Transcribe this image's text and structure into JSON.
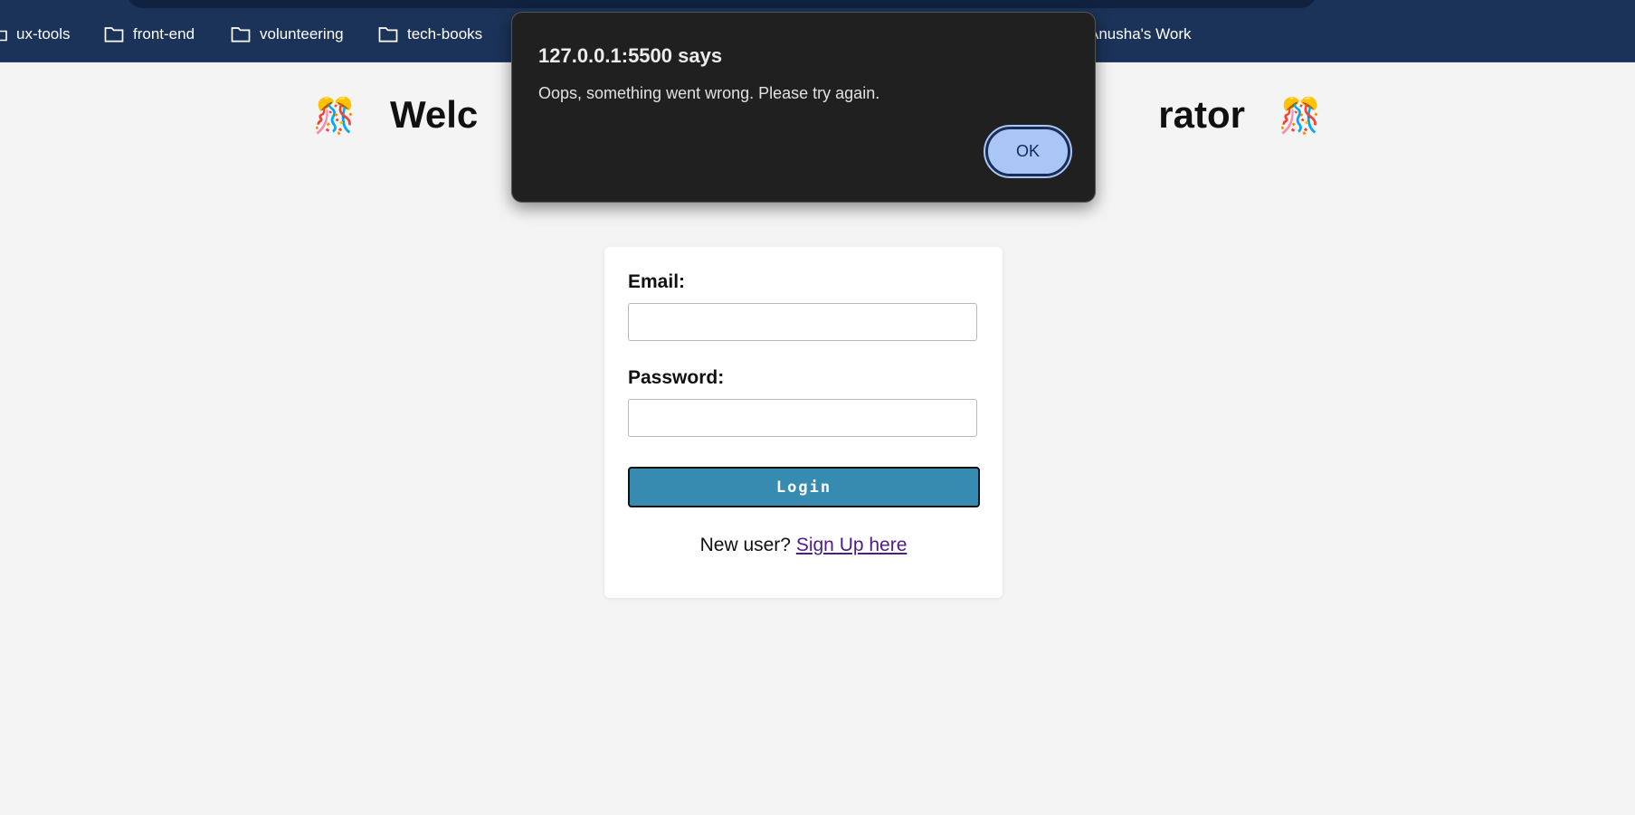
{
  "bookmarks": [
    {
      "label": "ux-tools",
      "icon": "folder-icon"
    },
    {
      "label": "front-end",
      "icon": "folder-icon"
    },
    {
      "label": "volunteering",
      "icon": "folder-icon"
    },
    {
      "label": "tech-books",
      "icon": "folder-icon"
    },
    {
      "label": "Anusha's Work",
      "icon": "none"
    }
  ],
  "page": {
    "title_visible_left": "Welc",
    "title_visible_right": "rator",
    "title_emoji": "🎊",
    "subtitle_visible": ""
  },
  "login_form": {
    "email_label": "Email:",
    "email_value": "",
    "password_label": "Password:",
    "password_value": "",
    "login_button_label": "Login",
    "signup_prompt": "New user?",
    "signup_link": "Sign Up here"
  },
  "alert": {
    "origin": "127.0.0.1:5500 says",
    "message": "Oops, something went wrong. Please try again.",
    "ok_label": "OK"
  },
  "colors": {
    "browser_bar": "#1b3358",
    "login_button": "#388bb0",
    "alert_background": "#202020",
    "ok_button": "#a9c6f6",
    "link": "#4b1c8a"
  }
}
